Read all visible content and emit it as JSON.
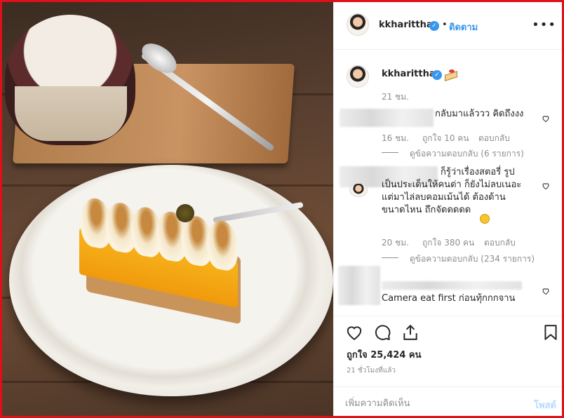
{
  "post": {
    "username": "kkharittha",
    "follow_label": "ติดตาม",
    "more_glyph": "•••"
  },
  "caption": {
    "username": "kkharittha",
    "emoji": "cake-icon",
    "time": "21 ชม."
  },
  "comments": [
    {
      "text": "กลับมาแล้ววว คิดถึงงง",
      "time": "16 ชม.",
      "likes": "ถูกใจ 10 คน",
      "reply": "ตอบกลับ",
      "view_replies": "ดูข้อความตอบกลับ (6 รายการ)"
    },
    {
      "text_lines": [
        "ก็รู้ว่าเรื่องสตอรี่ รูป",
        "เป็นประเด็นให้คนด่า ก็ยังไม่ลบเนอะ",
        "แต่มาไล่ลบคอมเม้นได้ ต้องด้าน",
        "ขนาดไหน ถึกจัดดดดด"
      ],
      "time": "20 ชม.",
      "likes": "ถูกใจ 380 คน",
      "reply": "ตอบกลับ",
      "view_replies": "ดูข้อความตอบกลับ (234 รายการ)"
    },
    {
      "text": "Camera eat first ก่อนทุ้กกกจาน"
    }
  ],
  "actions": {
    "likes": "ถูกใจ 25,424 คน",
    "time": "21 ชั่วโมงที่แล้ว"
  },
  "add_comment": {
    "placeholder": "เพิ่มความคิดเห็น",
    "post_label": "โพสต์"
  },
  "colors": {
    "link_blue": "#3897f0",
    "frame_red": "#e0101a"
  }
}
